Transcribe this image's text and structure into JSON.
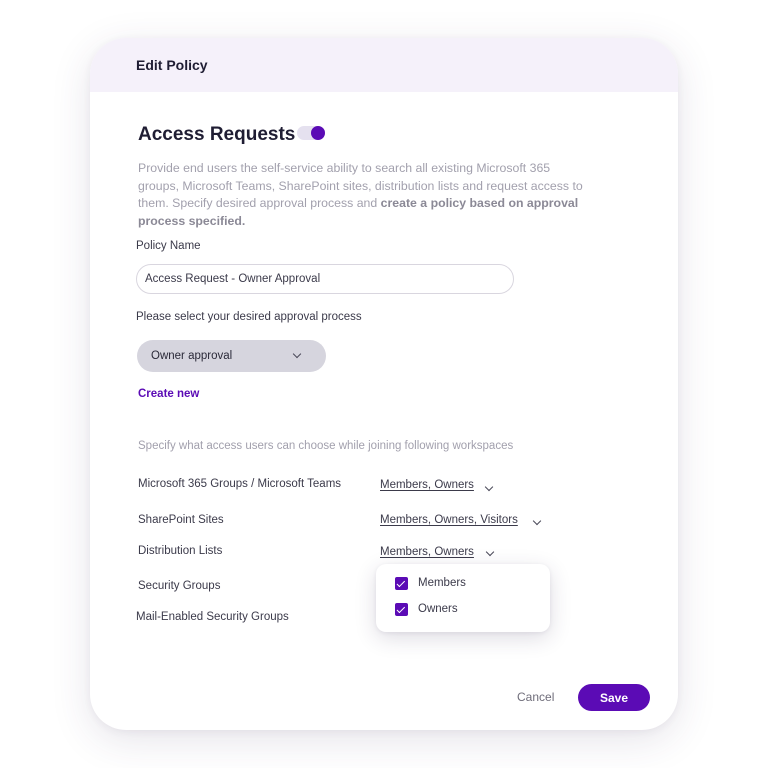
{
  "dialog": {
    "title": "Edit Policy"
  },
  "section": {
    "title": "Access Requests",
    "toggle_on": true,
    "description_plain": "Provide end users the self-service ability to search all existing Microsoft 365 groups, Microsoft Teams, SharePoint sites, distribution lists and request access to them. Specify desired approval process and ",
    "description_bold": "create a policy based on approval process specified."
  },
  "policy_name": {
    "label": "Policy Name",
    "value": "Access Request - Owner Approval"
  },
  "approval": {
    "label": "Please select your desired approval process",
    "selected": "Owner approval",
    "create_new": "Create new"
  },
  "workspaces": {
    "description": "Specify what access users can choose while joining following workspaces",
    "items": [
      {
        "label": "Microsoft 365 Groups / Microsoft Teams",
        "value": "Members, Owners"
      },
      {
        "label": "SharePoint Sites",
        "value": "Members, Owners, Visitors"
      },
      {
        "label": "Distribution Lists",
        "value": "Members, Owners"
      },
      {
        "label": "Security Groups",
        "value": ""
      },
      {
        "label": "Mail-Enabled Security Groups",
        "value": ""
      }
    ]
  },
  "dropdown_options": [
    {
      "label": "Members",
      "checked": true
    },
    {
      "label": "Owners",
      "checked": true
    }
  ],
  "footer": {
    "cancel_label": "Cancel",
    "save_label": "Save"
  },
  "colors": {
    "accent": "#5b0bb5",
    "header_background": "#f5f1fa",
    "select_background": "#d6d5de"
  }
}
